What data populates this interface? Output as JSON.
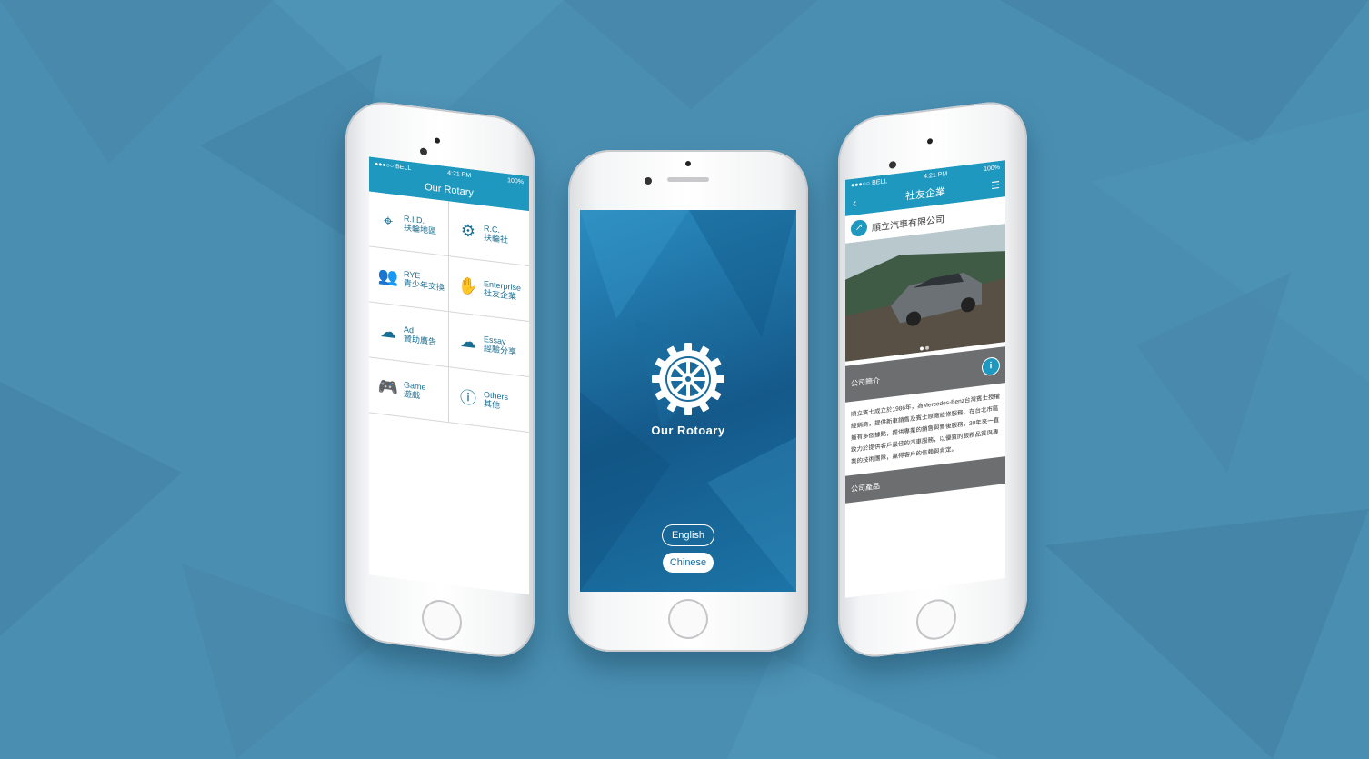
{
  "colors": {
    "background": "#4a8fb2",
    "accent": "#1f98c0",
    "dark_text": "#1a6e92",
    "splash": "#1c6d9e"
  },
  "left_phone": {
    "status": {
      "carrier": "●●●○○ BELL",
      "time": "4:21 PM",
      "battery": "100%"
    },
    "title": "Our Rotary",
    "menu": [
      {
        "icon": "map-pin-icon",
        "line1": "R.I.D.",
        "line2": "扶輪地區"
      },
      {
        "icon": "gear-wheel-icon",
        "line1": "R.C.",
        "line2": "扶輪社"
      },
      {
        "icon": "people-icon",
        "line1": "RYE",
        "line2": "青少年交換"
      },
      {
        "icon": "handshake-icon",
        "line1": "Enterprise",
        "line2": "社友企業"
      },
      {
        "icon": "cloud-ad-icon",
        "line1": "Ad",
        "line2": "贊助廣告"
      },
      {
        "icon": "cloud-essay-icon",
        "line1": "Essay",
        "line2": "經驗分享"
      },
      {
        "icon": "gamepad-icon",
        "line1": "Game",
        "line2": "遊戲"
      },
      {
        "icon": "info-icon",
        "line1": "Others",
        "line2": "其他"
      }
    ]
  },
  "center_phone": {
    "app_name": "Our Rotoary",
    "english_label": "English",
    "chinese_label": "Chinese"
  },
  "right_phone": {
    "status": {
      "carrier": "●●●○○ BELL",
      "time": "4:21 PM",
      "battery": "100%"
    },
    "title": "社友企業",
    "company": "順立汽車有限公司",
    "section1": "公司簡介",
    "description": "順立賓士成立於1986年，為Mercedes-Benz台灣賓士授權經銷商，提供新車銷售及賓士原廠維修服務。在台北市區擁有多個據點，提供專業的銷售與售後服務，30年來一直致力於提供客戶最佳的汽車服務，以優質的服務品質與專業的技術團隊，贏得客戶的信賴與肯定。",
    "section2": "公司產品"
  }
}
